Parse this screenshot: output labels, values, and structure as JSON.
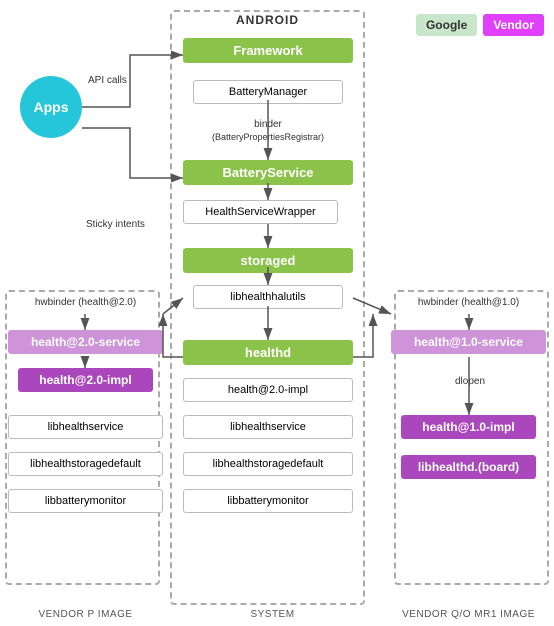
{
  "legend": {
    "google_label": "Google",
    "vendor_label": "Vendor"
  },
  "android": {
    "title": "ANDROID",
    "framework_label": "Framework",
    "battery_manager_label": "BatteryManager",
    "binder_label": "binder\n(BatteryPropertiesRegistrar)",
    "battery_service_label": "BatteryService",
    "health_service_wrapper_label": "HealthServiceWrapper",
    "storaged_label": "storaged",
    "libhealthhalutils_label": "libhealthhalutils",
    "healthd_label": "healthd",
    "healthd_health_impl_label": "health@2.0-impl",
    "healthd_libhealthservice_label": "libhealthservice",
    "healthd_libhealthstoragedefault_label": "libhealthstoragedefault",
    "healthd_libbatterymonitor_label": "libbatterymonitor"
  },
  "vendor_p": {
    "section_label": "VENDOR P IMAGE",
    "service_label": "health@2.0-service",
    "impl_label": "health@2.0-impl",
    "libhealthservice_label": "libhealthservice",
    "libhealthstoragedefault_label": "libhealthstoragedefault",
    "libbatterymonitor_label": "libbatterymonitor",
    "hwbinder_label": "hwbinder (health@2.0)"
  },
  "vendor_q": {
    "section_label": "VENDOR Q/O MR1 IMAGE",
    "service_label": "health@1.0-service",
    "impl_label": "health@1.0-impl",
    "libhealthd_label": "libhealthd.(board)",
    "hwbinder_label": "hwbinder (health@1.0)",
    "dlopen_label": "dlopen"
  },
  "apps": {
    "label": "Apps",
    "api_calls_label": "API\ncalls",
    "sticky_intents_label": "Sticky\nintents"
  },
  "col_labels": {
    "system": "SYSTEM"
  }
}
